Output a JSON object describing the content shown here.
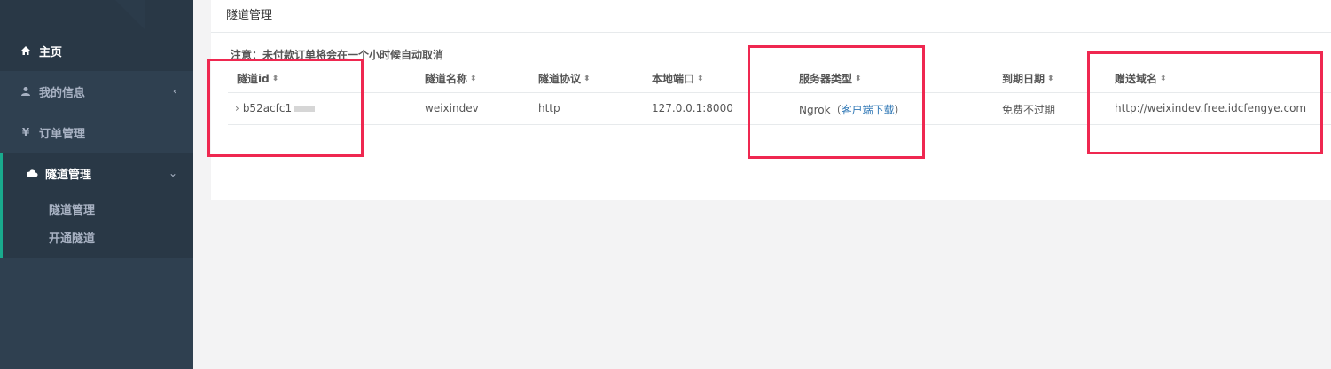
{
  "sidebar": {
    "items": [
      {
        "label": "主页",
        "icon": "home-icon"
      },
      {
        "label": "我的信息",
        "icon": "user-icon"
      },
      {
        "label": "订单管理",
        "icon": "yen-icon"
      },
      {
        "label": "隧道管理",
        "icon": "cloud-icon"
      }
    ],
    "sub_items": [
      {
        "label": "隧道管理"
      },
      {
        "label": "开通隧道"
      }
    ],
    "chevron_left": "‹",
    "chevron_down": "⌄"
  },
  "panel": {
    "title": "隧道管理",
    "notice": "注意：未付款订单将会在一个小时候自动取消"
  },
  "table": {
    "columns": [
      "隧道id",
      "隧道名称",
      "隧道协议",
      "本地端口",
      "服务器类型",
      "到期日期",
      "赠送域名"
    ],
    "sort_icon": "⬍",
    "rows": [
      {
        "expand": "›",
        "id": "b52acfc1",
        "name": "weixindev",
        "protocol": "http",
        "local_port": "127.0.0.1:8000",
        "server_type": "Ngrok",
        "server_link_open": "（",
        "server_link": "客户端下载",
        "server_link_close": "）",
        "expiry": "免费不过期",
        "domain": "http://weixindev.free.idcfengye.com"
      }
    ]
  },
  "colors": {
    "sidebar_bg": "#2f4050",
    "sidebar_active": "#293846",
    "accent": "#19aa8d",
    "annotation": "#ef2850",
    "link": "#337ab7"
  }
}
